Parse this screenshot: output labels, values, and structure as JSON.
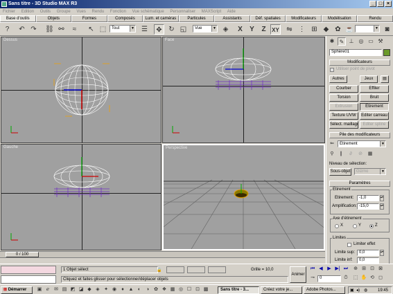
{
  "window": {
    "title": "Sans titre - 3D Studio MAX R3"
  },
  "menu": [
    "Fichier",
    "Edition",
    "Outils",
    "Groupe",
    "Vues",
    "Rendu",
    "Fonction",
    "Vue schématique",
    "Personnaliser",
    "MAXScript",
    "Aide"
  ],
  "tabs": [
    "Base d'outils",
    "Objets",
    "Formes",
    "Composés",
    "Lum. et caméras",
    "Particules",
    "Assistants",
    "Déf. spatiales",
    "Modificateurs",
    "Modélisation",
    "Rendu"
  ],
  "toolbar": {
    "selection_filter": "Tout",
    "coord_system": "Vue",
    "axes": [
      "X",
      "Y",
      "Z",
      "XY"
    ]
  },
  "viewports": {
    "top": "Dessus",
    "front": "Face",
    "left": "Gauche",
    "persp": "Perspective"
  },
  "command_panel": {
    "object_name": "Sphère01",
    "rollout_modifiers": "Modificateurs",
    "use_pivot": "Utiliser point de pivot",
    "others_btn": "Autres",
    "set_btn": "Jeux",
    "mod_buttons": [
      "Courber",
      "Effiler",
      "Torsion",
      "Bruit",
      "Extrusion",
      "Etirement",
      "Texture UVW",
      "Editer carreau",
      "Sélect. maillage",
      "Editer spline"
    ],
    "stack_header": "Pile des modificateurs",
    "stack_value": "Etirement",
    "sel_level": "Niveau de sélection:",
    "subobj": "Sous-objet",
    "gizmo": "Gizmo",
    "params_header": "Paramètres",
    "stretch_group": "Etirement",
    "stretch_label": "Etirement:",
    "stretch_val": "-1,0",
    "ampl_label": "Amplification:",
    "ampl_val": "-15,0",
    "axis_group": "Axe d'étirement",
    "axes": [
      "X",
      "Y",
      "Z"
    ],
    "limits_group": "Limites",
    "limit_effect": "Limiter effet",
    "upper_label": "Limite sup:",
    "upper_val": "0,0",
    "lower_label": "Limite inf:",
    "lower_val": "0,0"
  },
  "timeline": {
    "frame": "0 / 100"
  },
  "status": {
    "selection": "1 Objet sélect",
    "prompt": "Cliquez et faites glisser pour sélectionner/déplacer objets",
    "grid": "Grille = 10,0",
    "animate": "Animer",
    "frame_field": "0"
  },
  "taskbar": {
    "start": "Démarrer",
    "tasks": [
      "Sans titre - 3...",
      "Créez votre je...",
      "Adobe Photos..."
    ],
    "clock": "19:45"
  },
  "colors": {
    "title_start": "#0a246a",
    "viewport_bg": "#a0a0a0",
    "selection_box": "#f0a000",
    "object_swatch": "#6b9a2a"
  }
}
